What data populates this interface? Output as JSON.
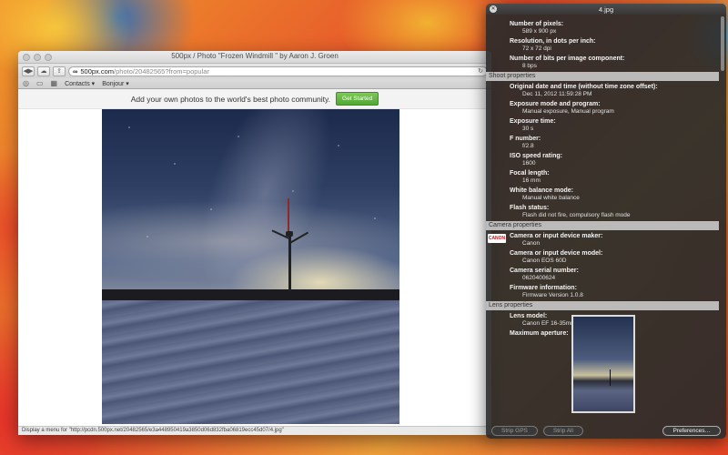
{
  "browser": {
    "window_title": "500px / Photo \"Frozen Windmill \" by Aaron J. Groen",
    "url_host": "500px.com",
    "url_path": "/photo/20482565?from=popular",
    "bookmarks": [
      "Contacts ▾",
      "Bonjour ▾"
    ],
    "promo_text": "Add your own photos to the world's best photo community.",
    "cta_label": "Get Started",
    "status_text": "Display a menu for \"http://pcdn.500px.net/20482565/e3a448950419a3850d06d832fba06819ecc45d07/4.jpg\""
  },
  "hud": {
    "title": "4.jpg",
    "top_props": [
      {
        "label": "Number of pixels:",
        "value": "589 x 900 px"
      },
      {
        "label": "Resolution, in dots per inch:",
        "value": "72 x 72 dpi"
      },
      {
        "label": "Number of bits per image component:",
        "value": "8 bps"
      }
    ],
    "shoot_header": "Shoot properties",
    "shoot_props": [
      {
        "label": "Original date and time (without time zone offset):",
        "value": "Dec 11, 2012 11:59:28 PM"
      },
      {
        "label": "Exposure mode and program:",
        "value": "Manual exposure, Manual program"
      },
      {
        "label": "Exposure time:",
        "value": "30 s"
      },
      {
        "label": "F number:",
        "value": "f/2.8"
      },
      {
        "label": "ISO speed rating:",
        "value": "1600"
      },
      {
        "label": "Focal length:",
        "value": "16 mm"
      },
      {
        "label": "White balance mode:",
        "value": "Manual white balance"
      },
      {
        "label": "Flash status:",
        "value": "Flash did not fire, compulsory flash mode"
      }
    ],
    "camera_header": "Camera properties",
    "camera_logo": "CANON",
    "camera_props": [
      {
        "label": "Camera or input device maker:",
        "value": "Canon"
      },
      {
        "label": "Camera or input device model:",
        "value": "Canon EOS 60D"
      },
      {
        "label": "Camera serial number:",
        "value": "0620400624"
      },
      {
        "label": "Firmware information:",
        "value": "Firmware Version 1.0.8"
      }
    ],
    "lens_header": "Lens properties",
    "lens_props": [
      {
        "label": "Lens model:",
        "value": "Canon EF 16-35mm f/2.8L II"
      },
      {
        "label": "Maximum aperture:",
        "value": ""
      }
    ],
    "buttons": {
      "strip_gps": "Strip GPS",
      "strip_all": "Strip All",
      "preferences": "Preferences…"
    }
  }
}
